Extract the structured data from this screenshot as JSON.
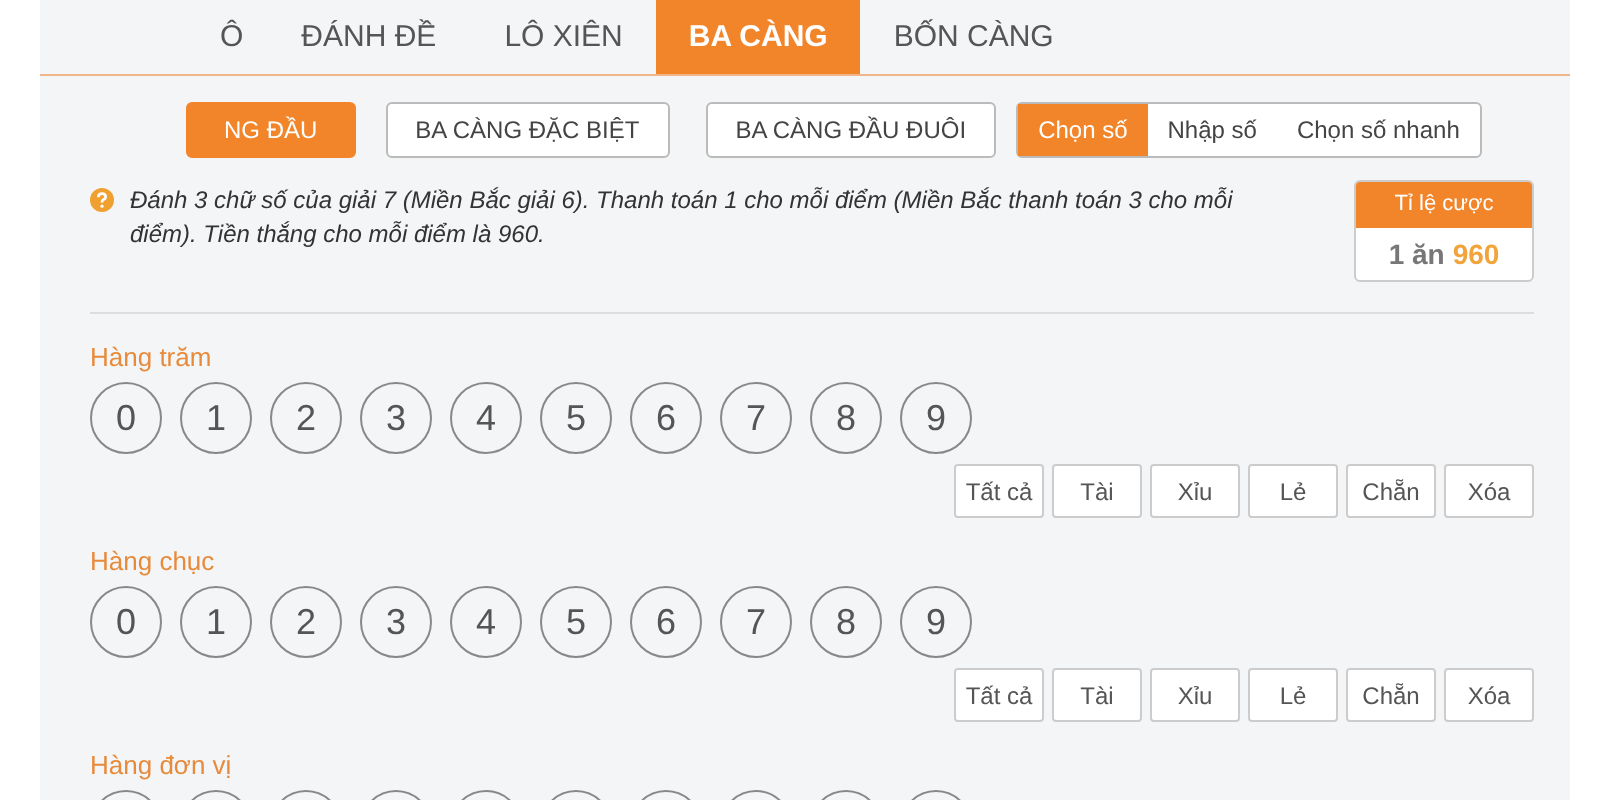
{
  "tabs": [
    {
      "label": "Ô",
      "selected": false
    },
    {
      "label": "ĐÁNH ĐỀ",
      "selected": false
    },
    {
      "label": "LÔ XIÊN",
      "selected": false
    },
    {
      "label": "BA CÀNG",
      "selected": true
    },
    {
      "label": "BỐN CÀNG",
      "selected": false
    }
  ],
  "bet_types": [
    {
      "label": "NG ĐẦU",
      "selected": true
    },
    {
      "label": "BA CÀNG ĐẶC BIỆT",
      "selected": false
    },
    {
      "label": "BA CÀNG ĐẦU ĐUÔI",
      "selected": false
    }
  ],
  "modes": [
    {
      "label": "Chọn số",
      "selected": true
    },
    {
      "label": "Nhập số",
      "selected": false
    },
    {
      "label": "Chọn số nhanh",
      "selected": false
    }
  ],
  "description": "Đánh 3 chữ số của giải 7 (Miền Bắc giải 6). Thanh toán 1 cho mỗi điểm (Miền Bắc thanh toán 3 cho mỗi điểm). Tiền thắng cho mỗi điểm là 960.",
  "odds": {
    "title": "Tỉ lệ cược",
    "prefix": "1 ăn",
    "value": "960"
  },
  "rows": [
    {
      "label": "Hàng trăm",
      "kind": "full",
      "digits": [
        "0",
        "1",
        "2",
        "3",
        "4",
        "5",
        "6",
        "7",
        "8",
        "9"
      ],
      "actions": [
        "Tất cả",
        "Tài",
        "Xỉu",
        "Lẻ",
        "Chẵn",
        "Xóa"
      ]
    },
    {
      "label": "Hàng chục",
      "kind": "full",
      "digits": [
        "0",
        "1",
        "2",
        "3",
        "4",
        "5",
        "6",
        "7",
        "8",
        "9"
      ],
      "actions": [
        "Tất cả",
        "Tài",
        "Xỉu",
        "Lẻ",
        "Chẵn",
        "Xóa"
      ]
    },
    {
      "label": "Hàng đơn vị",
      "kind": "cut"
    }
  ]
}
